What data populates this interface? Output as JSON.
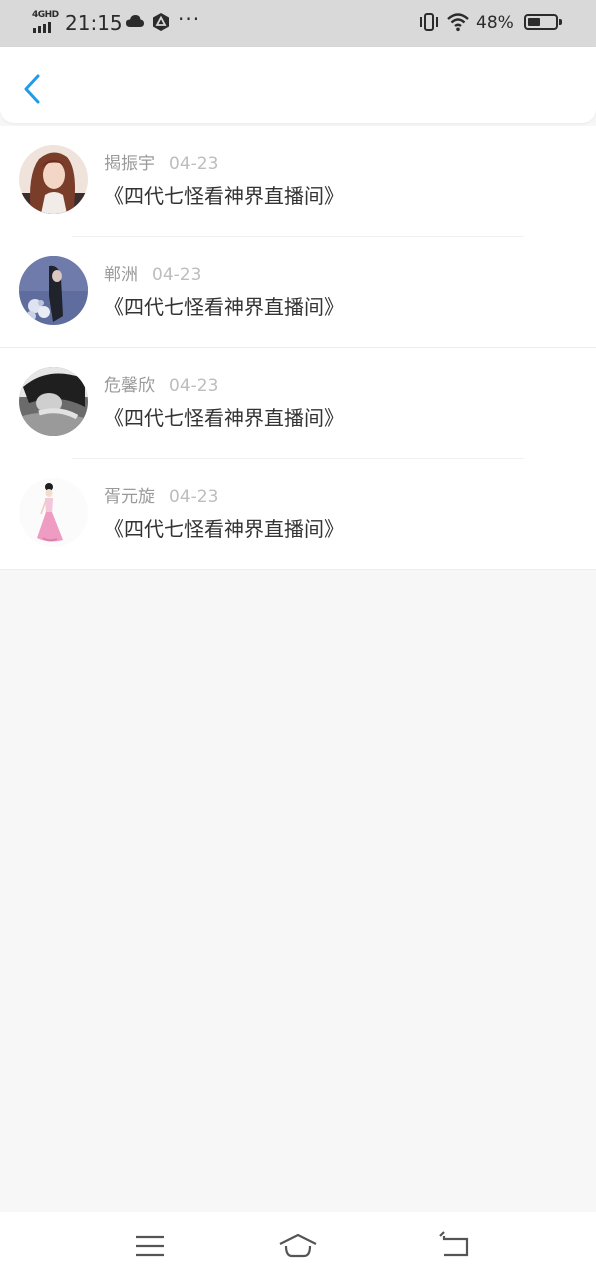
{
  "status_bar": {
    "network": "4GHD",
    "time": "21:15",
    "more": "···",
    "battery_percent": "48%",
    "battery_level": 0.48
  },
  "header": {
    "accent_color": "#1e9be9"
  },
  "list": {
    "items": [
      {
        "name": "揭振宇",
        "date": "04-23",
        "title": "《四代七怪看神界直播间》"
      },
      {
        "name": "郸洲",
        "date": "04-23",
        "title": "《四代七怪看神界直播间》"
      },
      {
        "name": "危馨欣",
        "date": "04-23",
        "title": "《四代七怪看神界直播间》"
      },
      {
        "name": "胥元旋",
        "date": "04-23",
        "title": "《四代七怪看神界直播间》"
      }
    ]
  }
}
